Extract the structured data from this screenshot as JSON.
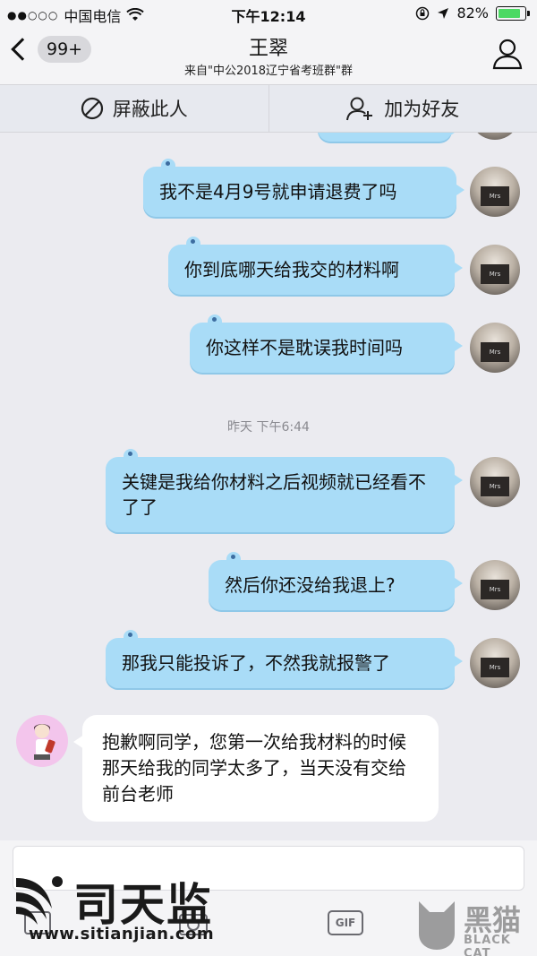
{
  "status_bar": {
    "carrier": "中国电信",
    "signal": "●●○○○",
    "time": "下午12:14",
    "battery_percent": "82%",
    "battery_level": 0.82
  },
  "header": {
    "back_badge": "99+",
    "title": "王翠",
    "subtitle": "来自\"中公2018辽宁省考班群\"群"
  },
  "actions": {
    "block_label": "屏蔽此人",
    "add_friend_label": "加为好友"
  },
  "messages": [
    {
      "side": "right",
      "text": "我不是4月9号就申请退费了吗"
    },
    {
      "side": "right",
      "text": "你到底哪天给我交的材料啊"
    },
    {
      "side": "right",
      "text": "你这样不是耽误我时间吗"
    },
    {
      "side": "right",
      "text": "关键是我给你材料之后视频就已经看不了了"
    },
    {
      "side": "right",
      "text": "然后你还没给我退上?"
    },
    {
      "side": "right",
      "text": "那我只能投诉了，不然我就报警了"
    },
    {
      "side": "left",
      "text": "抱歉啊同学，您第一次给我材料的时候那天给我的同学太多了，当天没有交给前台老师"
    }
  ],
  "timestamp": "昨天 下午6:44",
  "toolbar": {
    "gif_label": "GIF"
  },
  "watermarks": {
    "brand_cn": "司天监",
    "brand_url": "www.sitianjian.com",
    "cat_cn": "黑猫",
    "cat_en": "BLACK CAT"
  },
  "colors": {
    "bubble_out": "#a9dcf7",
    "bubble_in": "#ffffff",
    "background": "#ebebf0"
  }
}
